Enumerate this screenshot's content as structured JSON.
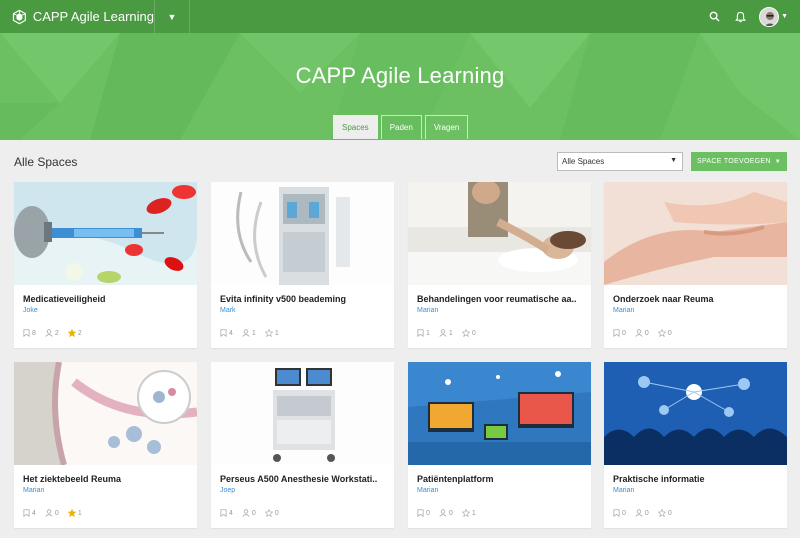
{
  "app": {
    "title": "CAPP Agile Learning"
  },
  "hero": {
    "title": "CAPP Agile Learning"
  },
  "tabs": [
    {
      "label": "Spaces",
      "active": true
    },
    {
      "label": "Paden",
      "active": false
    },
    {
      "label": "Vragen",
      "active": false
    }
  ],
  "toolbar": {
    "section_title": "Alle Spaces",
    "filter_value": "Alle Spaces",
    "add_button": "SPACE TOEVOEGEN"
  },
  "colors": {
    "nav": "#4a9a42",
    "hero": "#6cc062",
    "accent": "#6cc062",
    "author": "#3a8fd6",
    "star_active": "#e8b400"
  },
  "icons": [
    "logo-icon",
    "search-icon",
    "bell-icon",
    "avatar",
    "bookmark-icon",
    "user-icon",
    "star-icon"
  ],
  "spaces": [
    {
      "title": "Medicatieveiligheid",
      "author": "Joke",
      "bookmarks": "8",
      "users": "2",
      "stars": "2",
      "starred": true
    },
    {
      "title": "Evita infinity v500 beademing",
      "author": "Mark",
      "bookmarks": "4",
      "users": "1",
      "stars": "1",
      "starred": false
    },
    {
      "title": "Behandelingen voor reumatische aa..",
      "author": "Marian",
      "bookmarks": "1",
      "users": "1",
      "stars": "0",
      "starred": false
    },
    {
      "title": "Onderzoek naar Reuma",
      "author": "Marian",
      "bookmarks": "0",
      "users": "0",
      "stars": "0",
      "starred": false
    },
    {
      "title": "Het ziektebeeld Reuma",
      "author": "Marian",
      "bookmarks": "4",
      "users": "0",
      "stars": "1",
      "starred": true
    },
    {
      "title": "Perseus A500 Anesthesie Workstati..",
      "author": "Joep",
      "bookmarks": "4",
      "users": "0",
      "stars": "0",
      "starred": false
    },
    {
      "title": "Patiëntenplatform",
      "author": "Marian",
      "bookmarks": "0",
      "users": "0",
      "stars": "1",
      "starred": false
    },
    {
      "title": "Praktische informatie",
      "author": "Marian",
      "bookmarks": "0",
      "users": "0",
      "stars": "0",
      "starred": false
    }
  ]
}
